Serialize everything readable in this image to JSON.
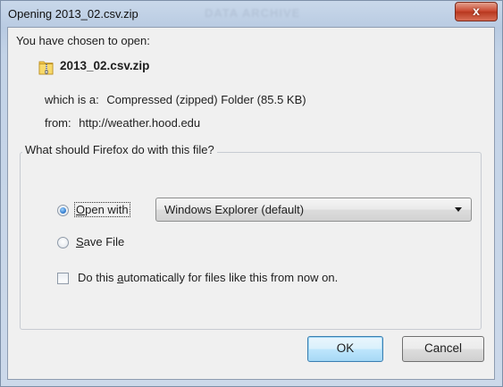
{
  "window": {
    "title": "Opening 2013_02.csv.zip",
    "watermark": "DATA ARCHIVE",
    "close_glyph": "x"
  },
  "intro": "You have chosen to open:",
  "file": {
    "icon": "zip-folder-icon",
    "name": "2013_02.csv.zip",
    "which_label": "which is a:",
    "type": "Compressed (zipped) Folder (85.5 KB)",
    "from_label": "from:",
    "source": "http://weather.hood.edu"
  },
  "action_group": {
    "legend": "What should Firefox do with this file?",
    "open_with": {
      "access_key": "O",
      "rest": "pen with",
      "selected": true
    },
    "app_select": {
      "value": "Windows Explorer (default)"
    },
    "save_file": {
      "access_key": "S",
      "rest": "ave File",
      "selected": false
    },
    "auto": {
      "before": "Do this ",
      "access_key": "a",
      "after": "utomatically for files like this from now on.",
      "checked": false
    }
  },
  "buttons": {
    "ok": "OK",
    "cancel": "Cancel"
  },
  "colors": {
    "accent": "#3c7fb1",
    "close": "#c9472f",
    "dialog_bg": "#f0f0f0"
  }
}
